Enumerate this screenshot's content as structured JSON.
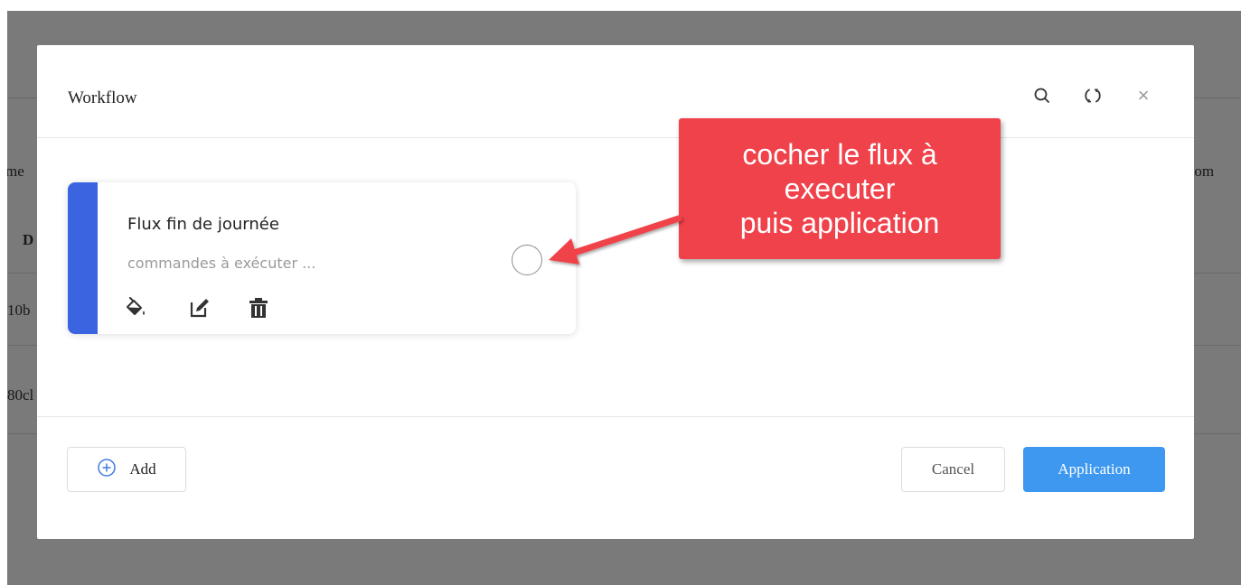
{
  "background": {
    "column_fragments": [
      "me",
      "stom"
    ],
    "row_fragments": [
      "D",
      "10b",
      "80cl"
    ]
  },
  "modal": {
    "title": "Workflow",
    "header_icons": [
      "search-icon",
      "refresh-icon",
      "close-icon"
    ],
    "close_glyph": "×"
  },
  "workflow_card": {
    "title": "Flux fin de journée",
    "description": "commandes à exécuter ...",
    "accent_color": "#3a64e0",
    "action_icons": [
      "paint-bucket-icon",
      "edit-icon",
      "trash-icon"
    ],
    "selected": false
  },
  "footer": {
    "add_label": "Add",
    "cancel_label": "Cancel",
    "apply_label": "Application",
    "apply_color": "#3e98f0"
  },
  "annotation": {
    "lines": [
      "cocher le flux à",
      "executer",
      "puis application"
    ],
    "color": "#f0424a"
  }
}
